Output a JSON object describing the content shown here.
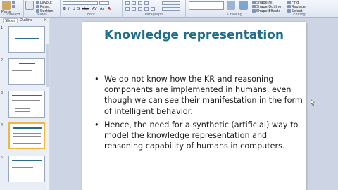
{
  "ribbon": {
    "clipboard": {
      "cut": "Cut",
      "copy": "Copy",
      "paste_label": "Paste",
      "format": "Format Painter",
      "label": "Clipboard"
    },
    "slides": {
      "layout": "Layout",
      "reset": "Reset",
      "section": "Section",
      "label": "Slides"
    },
    "font": {
      "label": "Font",
      "buttons": [
        "B",
        "I",
        "U",
        "S",
        "abc",
        "AV",
        "Aa",
        "A"
      ]
    },
    "paragraph": {
      "label": "Paragraph"
    },
    "drawing": {
      "label": "Drawing",
      "arrange": "Arrange",
      "quick_styles": "Quick Styles",
      "shape_fill": "Shape Fill",
      "shape_outline": "Shape Outline",
      "shape_effects": "Shape Effects"
    },
    "editing": {
      "label": "Editing",
      "find": "Find",
      "replace": "Replace",
      "select": "Select"
    }
  },
  "panel": {
    "tabs": [
      "Slides",
      "Outline"
    ],
    "close": "×",
    "slide_numbers": [
      "1",
      "2",
      "3",
      "4",
      "5"
    ],
    "selected_index": 3
  },
  "slide": {
    "title": "Knowledge representation",
    "bullets": [
      "We do not know how the KR and reasoning components are implemented in humans, even though we can see their manifestation in the form of intelligent behavior.",
      "Hence, the need for a synthetic (artificial) way to model the knowledge representation and reasoning capability of humans in computers."
    ],
    "bullet_char": "•"
  },
  "colors": {
    "title": "#1f6f8b",
    "selected_thumb_border": "#f2b544",
    "ribbon_bg": "#dfe6f1"
  }
}
